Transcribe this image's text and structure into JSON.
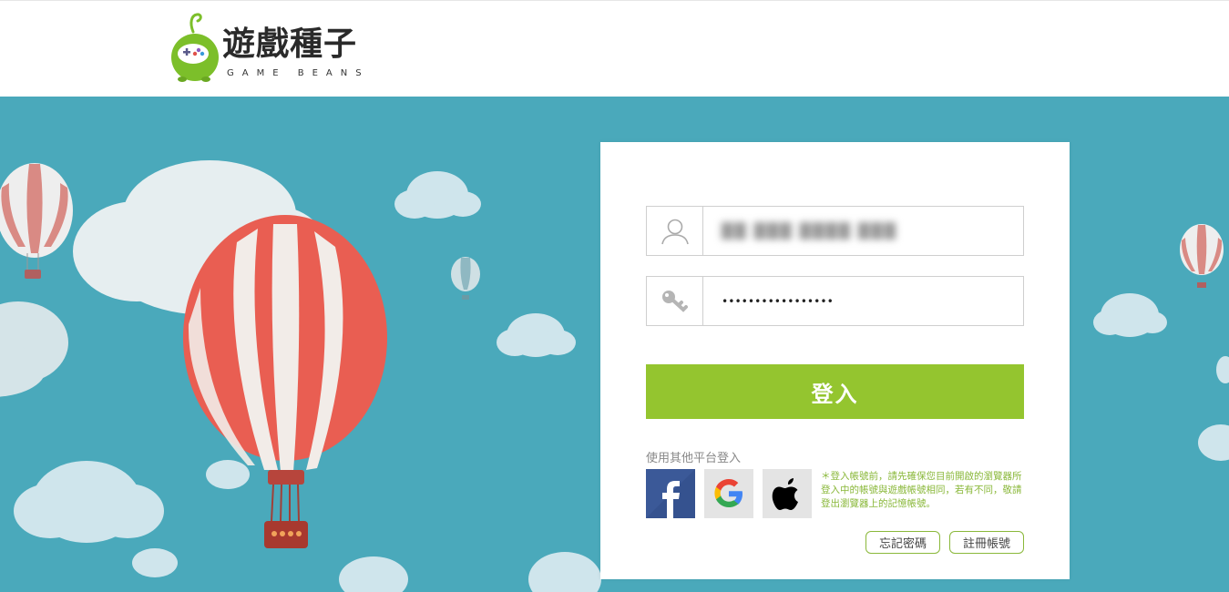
{
  "brand": {
    "name": "遊戲種子",
    "subtitle": "GAME BEANS",
    "accent_color": "#94c52f",
    "sky_color": "#4aa9bb"
  },
  "login": {
    "username_icon": "user-icon",
    "username_value": "██ ███ ████ ███",
    "password_icon": "key-icon",
    "password_value": "•••••••••••••••••",
    "submit_label": "登入",
    "other_platforms_label": "使用其他平台登入",
    "social": [
      {
        "name": "facebook",
        "icon": "facebook-icon"
      },
      {
        "name": "google",
        "icon": "google-icon"
      },
      {
        "name": "apple",
        "icon": "apple-icon"
      }
    ],
    "notice": "＊登入帳號前，請先確保您目前開啟的瀏覽器所登入中的帳號與遊戲帳號相同，若有不同，敬請登出瀏覽器上的記憶帳號。",
    "forgot_label": "忘記密碼",
    "register_label": "註冊帳號"
  }
}
